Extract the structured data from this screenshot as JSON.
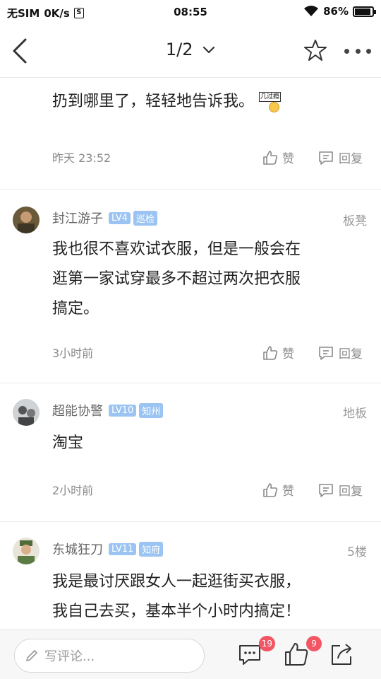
{
  "status_bar": {
    "carrier": "无SIM",
    "speed": "0K/s",
    "speed_icon_letter": "S",
    "time": "08:55",
    "battery": "86%",
    "battery_level": 0.86
  },
  "nav": {
    "page_indicator": "1/2"
  },
  "posts": [
    {
      "text": "扔到哪里了，轻轻地告诉我。",
      "emoji_text": "几过瘾",
      "time": "昨天 23:52",
      "like_label": "赞",
      "reply_label": "回复"
    },
    {
      "author": "封江游子",
      "level": "LV4",
      "rank": "巡检",
      "floor": "板凳",
      "text_lines": [
        "我也很不喜欢试衣服，但是一般会在",
        "逛第一家试穿最多不超过两次把衣服",
        "搞定。"
      ],
      "time": "3小时前",
      "like_label": "赞",
      "reply_label": "回复"
    },
    {
      "author": "超能协警",
      "level": "LV10",
      "rank": "知州",
      "floor": "地板",
      "text_lines": [
        "淘宝"
      ],
      "time": "2小时前",
      "like_label": "赞",
      "reply_label": "回复"
    },
    {
      "author": "东城狂刀",
      "level": "LV11",
      "rank": "知府",
      "floor": "5楼",
      "text_lines": [
        "我是最讨厌跟女人一起逛街买衣服，",
        "我自己去买，基本半个小时内搞定！"
      ]
    }
  ],
  "bottom_bar": {
    "comment_placeholder": "写评论...",
    "comment_count": "19",
    "like_count": "9"
  },
  "colors": {
    "badge": "#9bc4f2",
    "count_badge": "#f25564"
  }
}
